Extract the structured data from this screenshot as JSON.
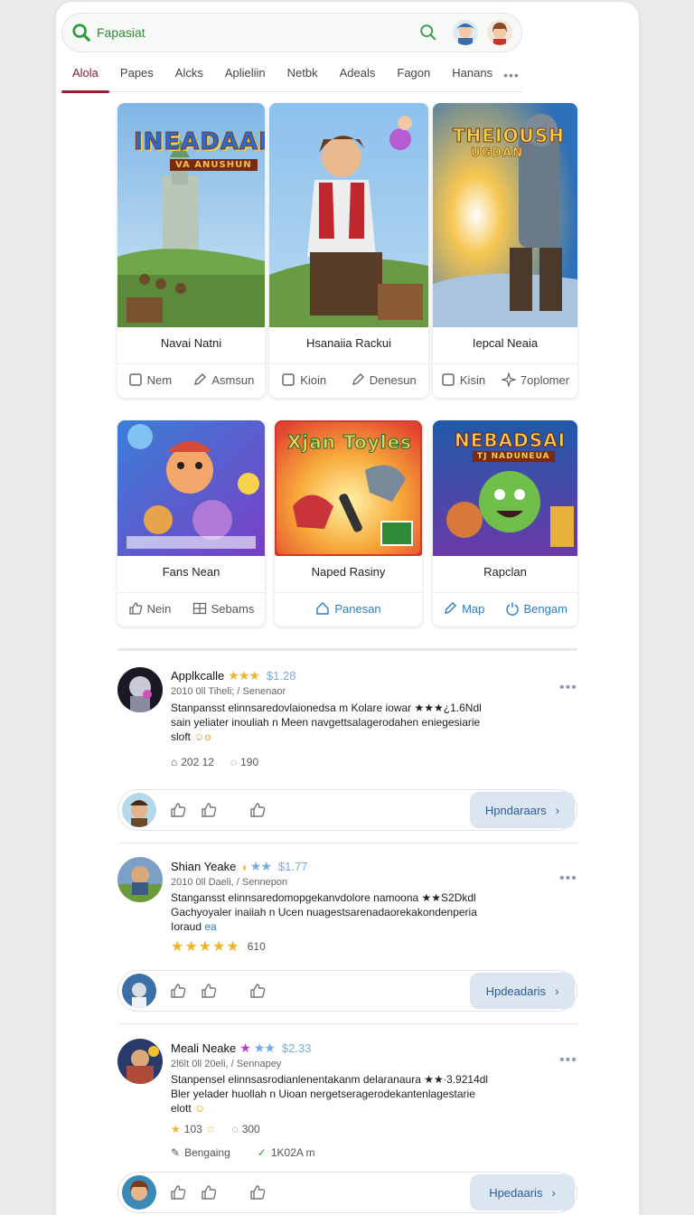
{
  "search": {
    "text": "Fapasiat"
  },
  "tabs": [
    "Alola",
    "Papes",
    "Alcks",
    "Aplieliin",
    "Netbk",
    "Adeals",
    "Fagon",
    "Hanans"
  ],
  "cards_row1": [
    {
      "art_text": "INEADAAII",
      "art_sub": "VA ANUSHUN",
      "title": "Navai Natni",
      "actions": [
        "Nem",
        "Asmsun"
      ]
    },
    {
      "title": "Hsanaiia Rackui",
      "actions": [
        "Kioin",
        "Denesun"
      ]
    },
    {
      "art_text": "THEIOUSH",
      "art_sub": "UGDAN",
      "title": "Iepcal Neaia",
      "actions": [
        "Kisin",
        "7oplomer"
      ]
    }
  ],
  "cards_row2": [
    {
      "title": "Fans Nean",
      "actions": [
        "Nein",
        "Sebams"
      ]
    },
    {
      "art_text": "Xjan Toyles",
      "title": "Naped Rasiny",
      "actions": [
        "Panesan"
      ]
    },
    {
      "art_text": "NEBADSAI",
      "art_sub": "TJ NADUNEUA",
      "title": "Rapclan",
      "actions": [
        "Map",
        "Bengam"
      ]
    }
  ],
  "posts": [
    {
      "name": "Applkcalle",
      "price": "$1.28",
      "meta": "2010 0ll Tiheli; / Senenaor",
      "body_lines": [
        "Stanpansst elinnsaredovlaionedsa m Kolare iowar ★★★¿1.6Ndl",
        "sain yeliater inouliah n Meen navgettsalagerodahen eniegesiarie",
        "sloft"
      ],
      "stats": [
        "202 12",
        "190"
      ],
      "reply_label": "Hpndaraars"
    },
    {
      "name": "Shian Yeake",
      "price": "$1.77",
      "meta": "2010 0ll Daeli, / Sennepon",
      "body_lines": [
        "Stangansst elinnsaredomopgekanvdolore namoona ★★S2Dkdl",
        "Gachyoyaler inaiiah n Ucen nuagestsarenadaorekakondenperia",
        "Ioraud"
      ],
      "body_suffix": "ea",
      "rating_count": "610",
      "reply_label": "Hpdeadaris"
    },
    {
      "name": "Meali Neake",
      "price": "$2.33",
      "meta": "2l6lt 0ll 20eli, / Sennapey",
      "body_lines": [
        "Stanpensel elinnsasrodianlenentakanm delaranaura ★★∙3.9214dl",
        "Bler yelader huollah n Uioan nergetseragerodekantenlagestarie",
        "elott"
      ],
      "stats": [
        "103",
        "300"
      ],
      "extras": [
        "Bengaing",
        "1K02A m"
      ],
      "reply_label": "Hpedaaris"
    }
  ],
  "colors": {
    "accent": "#9b1b2e",
    "search_green": "#2e8b3a",
    "link_blue": "#2a7cc8",
    "reply_bg": "#dbe6f2"
  }
}
